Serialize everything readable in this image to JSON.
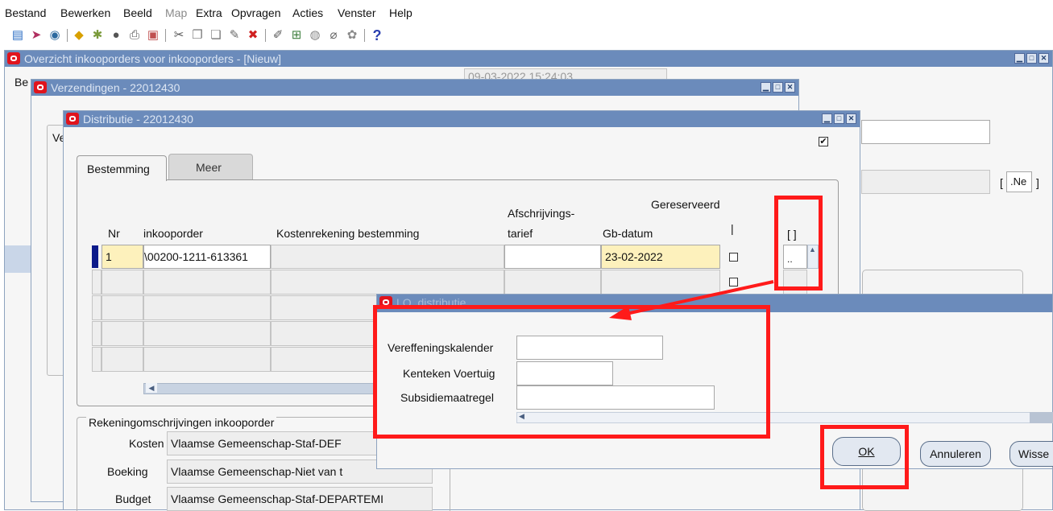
{
  "menu": [
    {
      "label": "Bestand",
      "disabled": false
    },
    {
      "label": "Bewerken",
      "disabled": false
    },
    {
      "label": "Beeld",
      "disabled": false
    },
    {
      "label": "Map",
      "disabled": true
    },
    {
      "label": "Extra",
      "disabled": false
    },
    {
      "label": "Opvragen",
      "disabled": false
    },
    {
      "label": "Acties",
      "disabled": false
    },
    {
      "label": "Venster",
      "disabled": false
    },
    {
      "label": "Help",
      "disabled": false
    }
  ],
  "toolbar": {
    "icons": [
      "new-record-icon",
      "navigate-icon",
      "zoom-icon",
      "save-icon",
      "next-step-icon",
      "switch-responsibility-icon",
      "print-icon",
      "close-form-icon",
      "cut-icon",
      "copy-icon",
      "paste-icon",
      "clear-record-icon",
      "delete-icon",
      "edit-field-icon",
      "zoom-attach-icon",
      "translations-icon",
      "attachments-icon",
      "folder-tools-icon",
      "help-icon"
    ],
    "help_glyph": "?"
  },
  "main_window": {
    "title": "Overzicht inkooporders voor inkooporders - [Nieuw]",
    "partial_label": "Be",
    "partial_value": "09-03-2022 15:24:03",
    "partial_right_value": ".Ne",
    "bracket_open": "[",
    "bracket_close": "]"
  },
  "shipments_window": {
    "title": "Verzendingen - 22012430",
    "partial_tab": "Ve"
  },
  "distribution_window": {
    "title": "Distributie - 22012430",
    "tabs": [
      {
        "label": "Bestemming",
        "active": true
      },
      {
        "label": "Meer",
        "active": false
      }
    ],
    "columns": {
      "nr": "Nr",
      "po": "inkooporder",
      "account": "Kostenrekening bestemming",
      "rate_line1": "Afschrijvings-",
      "rate_line2": "tarief",
      "gb_date": "Gb-datum",
      "reserved": "Gereserveerd",
      "reserved_bar": "|",
      "df": "[ ]"
    },
    "rows": [
      {
        "nr": "1",
        "po": "\\00200-1211-613361",
        "account": "",
        "rate": "",
        "gb_date": "23-02-2022",
        "reserved": false,
        "df": ".."
      }
    ],
    "accounts_section": {
      "title": "Rekeningomschrijvingen inkooporder",
      "items": [
        {
          "label": "Kosten",
          "value": "Vlaamse Gemeenschap-Staf-DEF"
        },
        {
          "label": "Boeking",
          "value": "Vlaamse Gemeenschap-Niet van t"
        },
        {
          "label": "Budget",
          "value": "Vlaamse Gemeenschap-Staf-DEPARTEMI"
        }
      ]
    }
  },
  "dff_window": {
    "title": "LO_distributie",
    "fields": [
      {
        "label": "Vereffeningskalender",
        "value": ""
      },
      {
        "label": "Kenteken Voertuig",
        "value": ""
      },
      {
        "label": "Subsidiemaatregel",
        "value": ""
      }
    ],
    "buttons": {
      "ok": "OK",
      "cancel": "Annuleren",
      "clear": "Wisse"
    }
  },
  "annotation": {
    "color": "#ff1a1a"
  }
}
